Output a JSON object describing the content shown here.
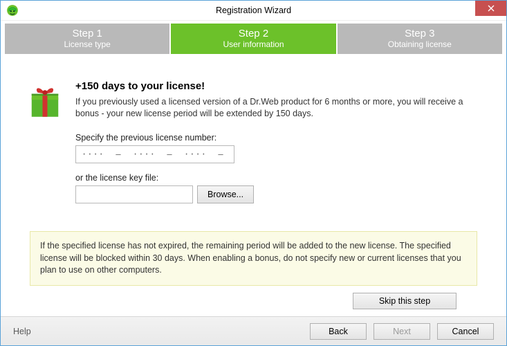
{
  "window": {
    "title": "Registration Wizard"
  },
  "steps": [
    {
      "num": "Step 1",
      "sub": "License type"
    },
    {
      "num": "Step 2",
      "sub": "User information"
    },
    {
      "num": "Step 3",
      "sub": "Obtaining license"
    }
  ],
  "active_step_index": 1,
  "promo": {
    "headline": "+150 days to your license!",
    "body": "If you previously used a licensed version of a Dr.Web product for 6 months or more, you will receive a bonus - your new license period will be extended by 150 days."
  },
  "form": {
    "prev_label": "Specify the previous license number:",
    "prev_value": "····  –  ····  –  ····  –  ····",
    "or_label": "or the license key file:",
    "file_value": "",
    "browse_label": "Browse..."
  },
  "note": "If the specified license has not expired, the remaining period will be added to the new license. The specified license will be blocked within 30 days. When enabling a bonus, do not specify new or current licenses that you plan to use on other computers.",
  "buttons": {
    "skip": "Skip this step",
    "help": "Help",
    "back": "Back",
    "next": "Next",
    "cancel": "Cancel"
  },
  "colors": {
    "accent_green": "#6cc12a",
    "step_inactive": "#b9b9b9",
    "close_red": "#c75050",
    "note_bg": "#fbfbe6"
  }
}
